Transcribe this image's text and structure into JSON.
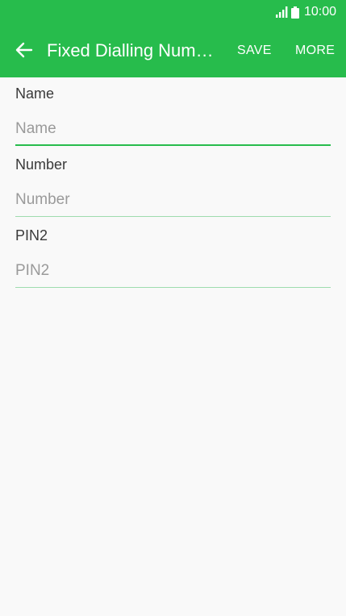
{
  "status_bar": {
    "time": "10:00",
    "signal_icon": "signal-icon",
    "battery_icon": "battery-icon"
  },
  "toolbar": {
    "back_icon": "back-arrow-icon",
    "title": "Fixed Dialling Numbers",
    "save_label": "SAVE",
    "more_label": "MORE"
  },
  "form": {
    "fields": [
      {
        "label": "Name",
        "placeholder": "Name",
        "value": "",
        "focused": true
      },
      {
        "label": "Number",
        "placeholder": "Number",
        "value": "",
        "focused": false
      },
      {
        "label": "PIN2",
        "placeholder": "PIN2",
        "value": "",
        "focused": false
      }
    ]
  },
  "colors": {
    "accent": "#27bc4c",
    "background": "#f9f9f9",
    "label_text": "#3a3a3a",
    "placeholder_text": "#9a9a9a",
    "idle_underline": "#9fdcae"
  }
}
